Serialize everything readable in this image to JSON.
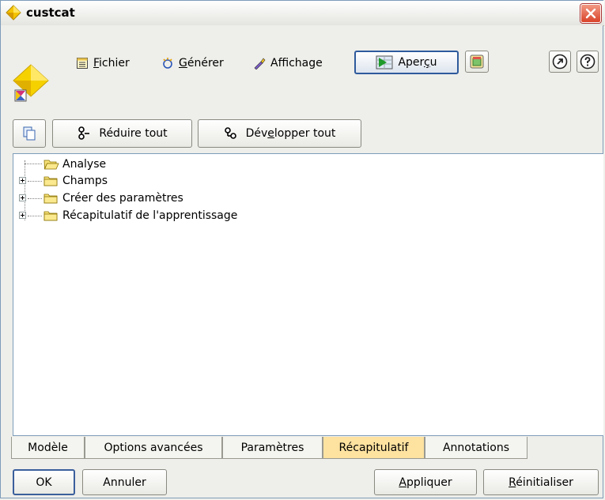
{
  "window": {
    "title": "custcat"
  },
  "menu": {
    "fichier_prefix": "",
    "fichier_u": "F",
    "fichier_rest": "ichier",
    "generer_u": "G",
    "generer_rest": "énérer",
    "affichage": "Affichage"
  },
  "toolbar": {
    "apercu_prefix": "Aper",
    "apercu_u": "ç",
    "apercu_rest": "u"
  },
  "tree_toolbar": {
    "collapse_all": "Réduire tout",
    "expand_prefix": "Dév",
    "expand_u": "e",
    "expand_rest": "lopper tout"
  },
  "tree": {
    "items": [
      {
        "label": "Analyse",
        "expandable": false,
        "open": true
      },
      {
        "label": "Champs",
        "expandable": true,
        "open": false
      },
      {
        "label": "Créer des paramètres",
        "expandable": true,
        "open": false
      },
      {
        "label": "Récapitulatif de l'apprentissage",
        "expandable": true,
        "open": false
      }
    ]
  },
  "tabs": [
    {
      "label": "Modèle",
      "active": false
    },
    {
      "label": "Options avancées",
      "active": false
    },
    {
      "label": "Paramètres",
      "active": false
    },
    {
      "label": "Récapitulatif",
      "active": true
    },
    {
      "label": "Annotations",
      "active": false
    }
  ],
  "buttons": {
    "ok": "OK",
    "cancel": "Annuler",
    "apply_u": "A",
    "apply_rest": "ppliquer",
    "reset_u": "R",
    "reset_rest": "éinitialiser"
  },
  "colors": {
    "active_tab": "#fde2a0",
    "close_button": "#d9432a",
    "tree_background": "#ffffff"
  }
}
